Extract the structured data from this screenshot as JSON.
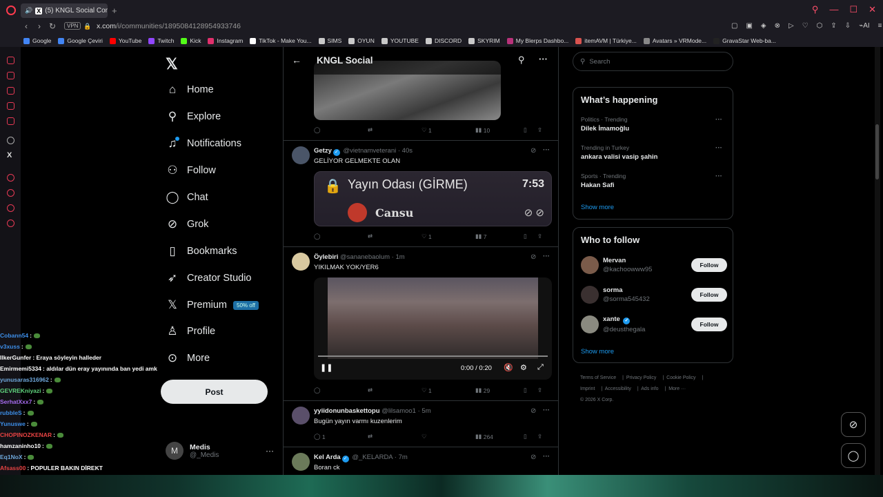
{
  "browser": {
    "tab_title": "(5) KNGL Social Comm",
    "url_host": "x.com",
    "url_path": "/i/communities/1895084128954933746",
    "vpn_label": "VPN",
    "bookmarks": [
      {
        "label": "Google",
        "color": "#4285f4"
      },
      {
        "label": "Google Çeviri",
        "color": "#4285f4"
      },
      {
        "label": "YouTube",
        "color": "#ff0000"
      },
      {
        "label": "Twitch",
        "color": "#9146ff"
      },
      {
        "label": "Kick",
        "color": "#53fc18"
      },
      {
        "label": "Instagram",
        "color": "#e1306c"
      },
      {
        "label": "TikTok - Make You...",
        "color": "#ffffff"
      },
      {
        "label": "SIMS",
        "color": "#c9c9c9"
      },
      {
        "label": "OYUN",
        "color": "#c9c9c9"
      },
      {
        "label": "YOUTUBE",
        "color": "#c9c9c9"
      },
      {
        "label": "DISCORD",
        "color": "#c9c9c9"
      },
      {
        "label": "SKYRIM",
        "color": "#c9c9c9"
      },
      {
        "label": "My Blerps Dashbo...",
        "color": "#b8327a"
      },
      {
        "label": "itemAVM | Türkiye...",
        "color": "#d9534f"
      },
      {
        "label": "Avatars » VRMode...",
        "color": "#888888"
      },
      {
        "label": "GravaStar Web-ba...",
        "color": "#222222"
      }
    ]
  },
  "nav": {
    "items": [
      {
        "label": "Home",
        "icon": "⌂"
      },
      {
        "label": "Explore",
        "icon": "⚲"
      },
      {
        "label": "Notifications",
        "icon": "🔔"
      },
      {
        "label": "Follow",
        "icon": "👤"
      },
      {
        "label": "Chat",
        "icon": "◯"
      },
      {
        "label": "Grok",
        "icon": "⊘"
      },
      {
        "label": "Bookmarks",
        "icon": "▯"
      },
      {
        "label": "Creator Studio",
        "icon": "🚀"
      },
      {
        "label": "Premium",
        "icon": "𝕏"
      },
      {
        "label": "Profile",
        "icon": "👤"
      },
      {
        "label": "More",
        "icon": "⋯"
      }
    ],
    "premium_badge": "50% off",
    "post_label": "Post",
    "account": {
      "name": "Medis",
      "handle": "@_Medis",
      "initial": "M"
    }
  },
  "feed": {
    "title": "KNGL Social",
    "tweets": [
      {
        "replies": "",
        "retweets": "",
        "likes": "1",
        "views": "10"
      },
      {
        "name": "Getzy",
        "verified": true,
        "handle": "@vietnamveterani",
        "time": "· 40s",
        "text": "GELİYOR GELMEKTE OLAN",
        "replies": "",
        "retweets": "",
        "likes": "1",
        "views": "7",
        "media": {
          "title": "Yayın Odası (GİRME)",
          "timer": "7:53",
          "user": "Cansu"
        }
      },
      {
        "name": "Öylebiri",
        "verified": false,
        "handle": "@sananebaolum",
        "time": "· 1m",
        "text": "YIKILMAK YOK/YER6",
        "replies": "",
        "retweets": "",
        "likes": "1",
        "views": "29",
        "media": {
          "time": "0:00 / 0:20"
        }
      },
      {
        "name": "yyiidonunbaskettopu",
        "verified": false,
        "handle": "@lilsamoo1",
        "time": "· 5m",
        "text": "Bugün yayın varmı kuzenlerim",
        "replies": "1",
        "retweets": "",
        "likes": "",
        "views": "264"
      },
      {
        "name": "Kel Arda",
        "verified": true,
        "handle": "@_KELARDA",
        "time": "· 7m",
        "text": "Boran ck"
      }
    ]
  },
  "right": {
    "search_placeholder": "Search",
    "happening_title": "What’s happening",
    "trends": [
      {
        "category": "Politics · Trending",
        "title": "Dilek İmamoğlu"
      },
      {
        "category": "Trending in Turkey",
        "title": "ankara valisi vasip şahin"
      },
      {
        "category": "Sports · Trending",
        "title": "Hakan Safi"
      }
    ],
    "show_more": "Show more",
    "wtf_title": "Who to follow",
    "follow_label": "Follow",
    "suggestions": [
      {
        "name": "Mervan",
        "handle": "@kachoowww95",
        "verified": false,
        "color": "#7a5b4a"
      },
      {
        "name": "sorma",
        "handle": "@sorma545432",
        "verified": false,
        "color": "#3a3030"
      },
      {
        "name": "xante",
        "handle": "@deusthegala",
        "verified": true,
        "color": "#8a8a80"
      }
    ],
    "footer": [
      "Terms of Service",
      "Privacy Policy",
      "Cookie Policy",
      "Imprint",
      "Accessibility",
      "Ads info",
      "More ···",
      "© 2026 X Corp."
    ]
  },
  "chat": [
    {
      "user": "Cobann54",
      "msg": ":",
      "color": "#3d8ee8"
    },
    {
      "user": "v3xuss",
      "msg": ":",
      "color": "#3d8ee8"
    },
    {
      "user": "IlkerGunfer",
      "msg": ": Eraya söyleyin halleder",
      "color": "#ffffff"
    },
    {
      "user": "Emirmemi5334",
      "msg": ": aldılar dün eray yayınında ban yedi amk",
      "color": "#ffffff"
    },
    {
      "user": "yunusaras316962",
      "msg": ":",
      "color": "#6fa8dc"
    },
    {
      "user": "GEVREKniyazi",
      "msg": ":",
      "color": "#5fd37d"
    },
    {
      "user": "SerhatXxx7",
      "msg": ":",
      "color": "#a86cf0"
    },
    {
      "user": "rubbleS",
      "msg": ":",
      "color": "#3d8ee8"
    },
    {
      "user": "Yunuswe",
      "msg": ":",
      "color": "#3d8ee8"
    },
    {
      "user": "CHOPINOZKENAR",
      "msg": ":",
      "color": "#e84343"
    },
    {
      "user": "hamzaninho10",
      "msg": ":",
      "color": "#ffffff"
    },
    {
      "user": "Eq1NoX",
      "msg": ":",
      "color": "#6fa8dc"
    },
    {
      "user": "Afsass00",
      "msg": ": POPULER BAKIN DİREKT",
      "color": "#e84343"
    }
  ]
}
